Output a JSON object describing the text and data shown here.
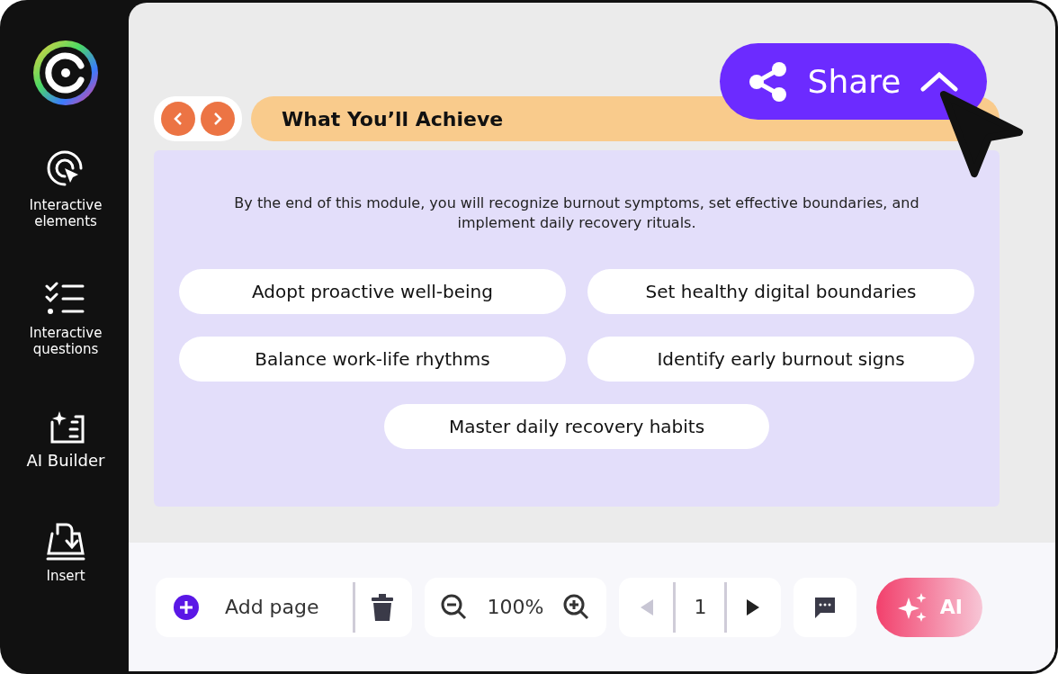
{
  "sidebar": {
    "items": [
      {
        "kind": "elements",
        "label": "Interactive elements"
      },
      {
        "kind": "questions",
        "label": "Interactive questions"
      },
      {
        "kind": "builder",
        "label": "AI Builder"
      },
      {
        "kind": "insert",
        "label": "Insert"
      }
    ]
  },
  "header": {
    "title": "What You’ll Achieve",
    "share": {
      "label": "Share",
      "expanded": false
    }
  },
  "content": {
    "description": "By the end of this module, you will recognize burnout symptoms, set effective boundaries, and implement daily recovery rituals.",
    "chips": [
      "Adopt proactive well-being",
      "Set healthy digital boundaries",
      "Balance work-life rhythms",
      "Identify early burnout signs",
      "Master daily recovery habits"
    ]
  },
  "toolbar": {
    "add_page": "Add page",
    "zoom": "100%",
    "page": "1",
    "prev_disabled": true,
    "next_disabled": false,
    "ai": "AI"
  }
}
